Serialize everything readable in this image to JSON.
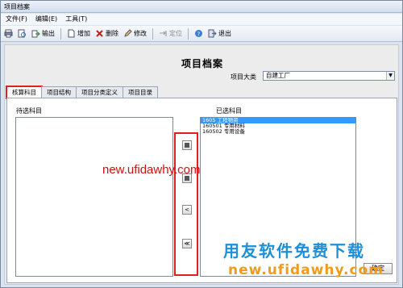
{
  "window": {
    "title": "项目档案"
  },
  "menu": [
    "文件(F)",
    "编辑(E)",
    "工具(T)"
  ],
  "toolbar": {
    "output": "输出",
    "add": "增加",
    "delete": "删除",
    "modify": "修改",
    "locate": "定位",
    "exit": "退出"
  },
  "main": {
    "heading": "项目档案",
    "category_label": "项目大类",
    "category_value": "自建工厂"
  },
  "tabs": [
    "核算科目",
    "项目结构",
    "项目分类定义",
    "项目目录"
  ],
  "panel": {
    "left_label": "待选科目",
    "right_label": "已选科目",
    "selected_items": [
      "1605 工程物资",
      "160501 专用材料",
      "160502 专用设备"
    ],
    "move_buttons": [
      "",
      "",
      "<",
      "≪"
    ],
    "confirm": "确定"
  },
  "watermark": {
    "url": "new.ufidawhy.com",
    "cn": "用友软件免费下载",
    "url2": "new.ufidawhy.com"
  },
  "colors": {
    "highlight": "#e0201a",
    "selection": "#3399ff",
    "accent_blue": "#1f8fd8",
    "accent_orange": "#f29a1a"
  }
}
